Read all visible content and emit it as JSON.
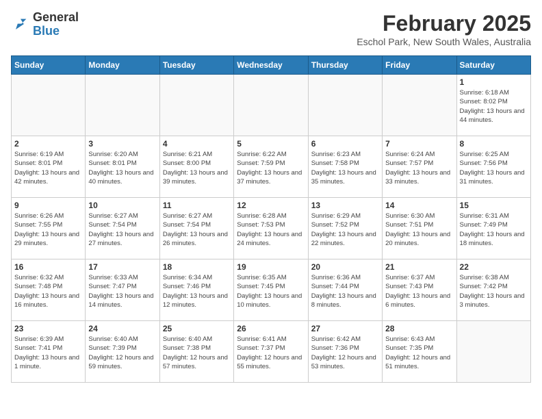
{
  "header": {
    "logo": {
      "general": "General",
      "blue": "Blue",
      "tagline": "GeneralBlue"
    },
    "title": "February 2025",
    "subtitle": "Eschol Park, New South Wales, Australia"
  },
  "weekdays": [
    "Sunday",
    "Monday",
    "Tuesday",
    "Wednesday",
    "Thursday",
    "Friday",
    "Saturday"
  ],
  "weeks": [
    [
      {
        "day": "",
        "empty": true
      },
      {
        "day": "",
        "empty": true
      },
      {
        "day": "",
        "empty": true
      },
      {
        "day": "",
        "empty": true
      },
      {
        "day": "",
        "empty": true
      },
      {
        "day": "",
        "empty": true
      },
      {
        "day": "1",
        "sunrise": "6:18 AM",
        "sunset": "8:02 PM",
        "daylight": "13 hours and 44 minutes."
      }
    ],
    [
      {
        "day": "2",
        "sunrise": "6:19 AM",
        "sunset": "8:01 PM",
        "daylight": "13 hours and 42 minutes."
      },
      {
        "day": "3",
        "sunrise": "6:20 AM",
        "sunset": "8:01 PM",
        "daylight": "13 hours and 40 minutes."
      },
      {
        "day": "4",
        "sunrise": "6:21 AM",
        "sunset": "8:00 PM",
        "daylight": "13 hours and 39 minutes."
      },
      {
        "day": "5",
        "sunrise": "6:22 AM",
        "sunset": "7:59 PM",
        "daylight": "13 hours and 37 minutes."
      },
      {
        "day": "6",
        "sunrise": "6:23 AM",
        "sunset": "7:58 PM",
        "daylight": "13 hours and 35 minutes."
      },
      {
        "day": "7",
        "sunrise": "6:24 AM",
        "sunset": "7:57 PM",
        "daylight": "13 hours and 33 minutes."
      },
      {
        "day": "8",
        "sunrise": "6:25 AM",
        "sunset": "7:56 PM",
        "daylight": "13 hours and 31 minutes."
      }
    ],
    [
      {
        "day": "9",
        "sunrise": "6:26 AM",
        "sunset": "7:55 PM",
        "daylight": "13 hours and 29 minutes."
      },
      {
        "day": "10",
        "sunrise": "6:27 AM",
        "sunset": "7:54 PM",
        "daylight": "13 hours and 27 minutes."
      },
      {
        "day": "11",
        "sunrise": "6:27 AM",
        "sunset": "7:54 PM",
        "daylight": "13 hours and 26 minutes."
      },
      {
        "day": "12",
        "sunrise": "6:28 AM",
        "sunset": "7:53 PM",
        "daylight": "13 hours and 24 minutes."
      },
      {
        "day": "13",
        "sunrise": "6:29 AM",
        "sunset": "7:52 PM",
        "daylight": "13 hours and 22 minutes."
      },
      {
        "day": "14",
        "sunrise": "6:30 AM",
        "sunset": "7:51 PM",
        "daylight": "13 hours and 20 minutes."
      },
      {
        "day": "15",
        "sunrise": "6:31 AM",
        "sunset": "7:49 PM",
        "daylight": "13 hours and 18 minutes."
      }
    ],
    [
      {
        "day": "16",
        "sunrise": "6:32 AM",
        "sunset": "7:48 PM",
        "daylight": "13 hours and 16 minutes."
      },
      {
        "day": "17",
        "sunrise": "6:33 AM",
        "sunset": "7:47 PM",
        "daylight": "13 hours and 14 minutes."
      },
      {
        "day": "18",
        "sunrise": "6:34 AM",
        "sunset": "7:46 PM",
        "daylight": "13 hours and 12 minutes."
      },
      {
        "day": "19",
        "sunrise": "6:35 AM",
        "sunset": "7:45 PM",
        "daylight": "13 hours and 10 minutes."
      },
      {
        "day": "20",
        "sunrise": "6:36 AM",
        "sunset": "7:44 PM",
        "daylight": "13 hours and 8 minutes."
      },
      {
        "day": "21",
        "sunrise": "6:37 AM",
        "sunset": "7:43 PM",
        "daylight": "13 hours and 6 minutes."
      },
      {
        "day": "22",
        "sunrise": "6:38 AM",
        "sunset": "7:42 PM",
        "daylight": "13 hours and 3 minutes."
      }
    ],
    [
      {
        "day": "23",
        "sunrise": "6:39 AM",
        "sunset": "7:41 PM",
        "daylight": "13 hours and 1 minute."
      },
      {
        "day": "24",
        "sunrise": "6:40 AM",
        "sunset": "7:39 PM",
        "daylight": "12 hours and 59 minutes."
      },
      {
        "day": "25",
        "sunrise": "6:40 AM",
        "sunset": "7:38 PM",
        "daylight": "12 hours and 57 minutes."
      },
      {
        "day": "26",
        "sunrise": "6:41 AM",
        "sunset": "7:37 PM",
        "daylight": "12 hours and 55 minutes."
      },
      {
        "day": "27",
        "sunrise": "6:42 AM",
        "sunset": "7:36 PM",
        "daylight": "12 hours and 53 minutes."
      },
      {
        "day": "28",
        "sunrise": "6:43 AM",
        "sunset": "7:35 PM",
        "daylight": "12 hours and 51 minutes."
      },
      {
        "day": "",
        "empty": true
      }
    ]
  ]
}
